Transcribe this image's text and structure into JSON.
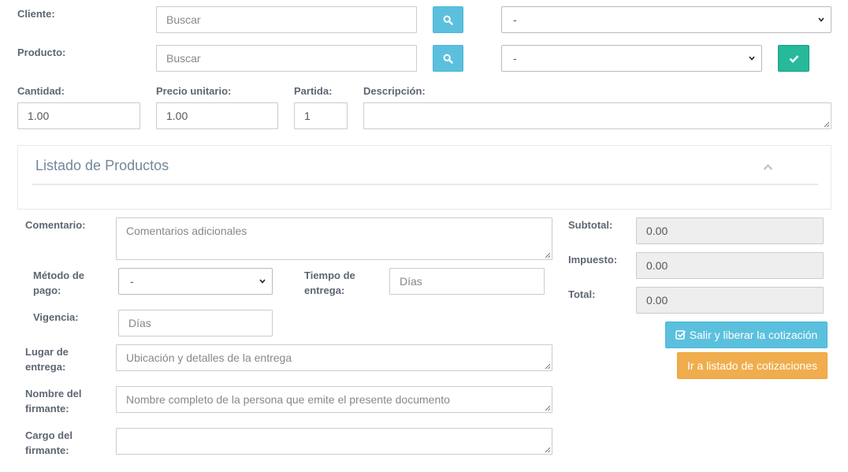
{
  "form": {
    "cliente": {
      "label": "Cliente:",
      "search_placeholder": "Buscar",
      "select_value": "-"
    },
    "producto": {
      "label": "Producto:",
      "search_placeholder": "Buscar",
      "select_value": "-"
    },
    "cantidad": {
      "label": "Cantidad:",
      "value": "1.00"
    },
    "precio_unitario": {
      "label": "Precio unitario:",
      "value": "1.00"
    },
    "partida": {
      "label": "Partida:",
      "value": "1"
    },
    "descripcion": {
      "label": "Descripción:",
      "value": ""
    }
  },
  "panel": {
    "title": "Listado de Productos"
  },
  "details": {
    "comentario": {
      "label": "Comentario:",
      "placeholder": "Comentarios adicionales"
    },
    "metodo_pago": {
      "label_line1": "Método de",
      "label_line2": "pago:",
      "select_value": "-"
    },
    "tiempo_entrega": {
      "label_line1": "Tiempo de",
      "label_line2": "entrega:",
      "placeholder": "Días"
    },
    "vigencia": {
      "label": "Vigencia:",
      "placeholder": "Días"
    },
    "lugar_entrega": {
      "label_line1": "Lugar de",
      "label_line2": "entrega:",
      "placeholder": "Ubicación y detalles de la entrega"
    },
    "nombre_firmante": {
      "label_line1": "Nombre del",
      "label_line2": "firmante:",
      "placeholder": "Nombre completo de la persona que emite el presente documento"
    },
    "cargo_firmante": {
      "label_line1": "Cargo del",
      "label_line2": "firmante:",
      "placeholder": ""
    }
  },
  "totals": {
    "subtotal": {
      "label": "Subtotal:",
      "value": "0.00"
    },
    "impuesto": {
      "label": "Impuesto:",
      "value": "0.00"
    },
    "total": {
      "label": "Total:",
      "value": "0.00"
    }
  },
  "actions": {
    "salir_label": "Salir y liberar la cotización",
    "listado_label": "Ir a listado de cotizaciones"
  },
  "colors": {
    "info": "#5bc0de",
    "success": "#26b99a",
    "warning": "#f0ad4e",
    "label": "#5d6673"
  },
  "icons": [
    "search-icon",
    "check-icon",
    "chevron-down-icon",
    "chevron-up-icon",
    "check-square-icon"
  ]
}
